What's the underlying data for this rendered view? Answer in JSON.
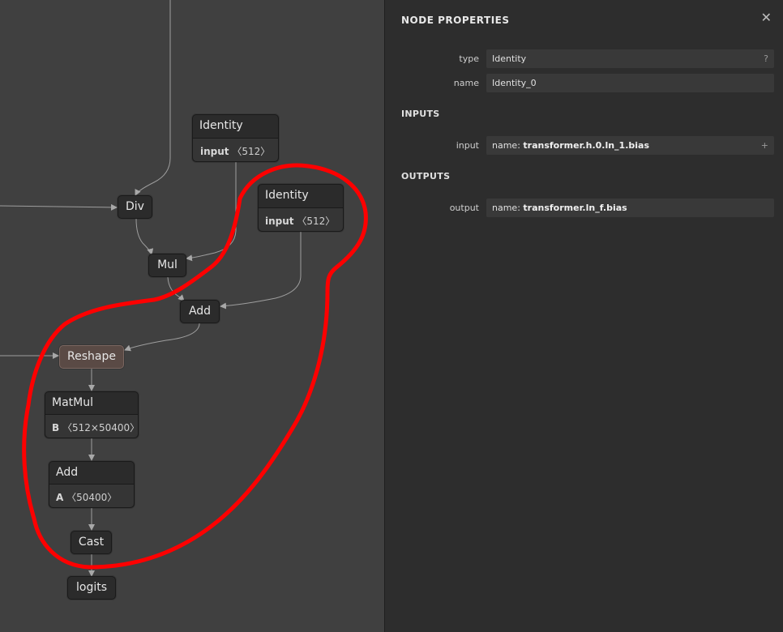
{
  "graph": {
    "nodes": {
      "identity_a": {
        "title": "Identity",
        "attr_name": "input",
        "attr_value": "〈512〉"
      },
      "div": {
        "title": "Div"
      },
      "identity_b": {
        "title": "Identity",
        "attr_name": "input",
        "attr_value": "〈512〉"
      },
      "mul": {
        "title": "Mul"
      },
      "add_a": {
        "title": "Add"
      },
      "reshape": {
        "title": "Reshape"
      },
      "matmul": {
        "title": "MatMul",
        "attr_name": "B",
        "attr_value": "〈512×50400〉"
      },
      "add_b": {
        "title": "Add",
        "attr_name": "A",
        "attr_value": "〈50400〉"
      },
      "cast": {
        "title": "Cast"
      },
      "logits": {
        "title": "logits"
      }
    },
    "edge_color": "#9e9e9e",
    "selected_color": "#5a4a45",
    "annotation_color": "#ff0000"
  },
  "panel": {
    "title": "NODE PROPERTIES",
    "close_symbol": "✕",
    "type_label": "type",
    "type_value": "Identity",
    "type_help": "?",
    "name_label": "name",
    "name_value": "Identity_0",
    "inputs_heading": "INPUTS",
    "input_label": "input",
    "input_prefix": "name: ",
    "input_value": "transformer.h.0.ln_1.bias",
    "input_expand": "+",
    "outputs_heading": "OUTPUTS",
    "output_label": "output",
    "output_prefix": "name: ",
    "output_value": "transformer.ln_f.bias"
  }
}
